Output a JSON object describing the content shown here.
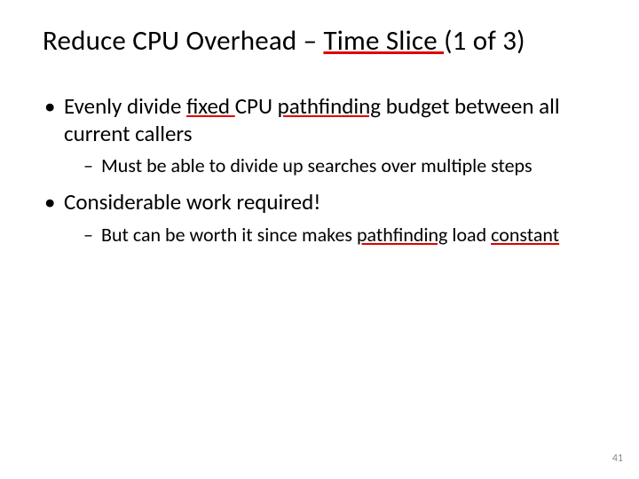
{
  "title": {
    "segments": [
      {
        "text": "Reduce CPU Overhead – ",
        "underline": false
      },
      {
        "text": "Time Slice ",
        "underline": true
      },
      {
        "text": "(1 of 3)",
        "underline": false
      }
    ]
  },
  "bullets": [
    {
      "segments": [
        {
          "text": "Evenly divide ",
          "underline": false
        },
        {
          "text": "fixed ",
          "underline": true
        },
        {
          "text": "CPU ",
          "underline": false
        },
        {
          "text": "pathfinding",
          "underline": true
        },
        {
          "text": " budget between all current callers",
          "underline": false
        }
      ],
      "sub": [
        {
          "text": "Must be able to divide up searches over multiple steps"
        }
      ]
    },
    {
      "segments": [
        {
          "text": "Considerable work required!",
          "underline": false
        }
      ],
      "sub": [
        {
          "segments": [
            {
              "text": "But can be worth it since makes ",
              "underline": false
            },
            {
              "text": "pathfinding",
              "underline": true
            },
            {
              "text": " load ",
              "underline": false
            },
            {
              "text": "constant",
              "underline": true
            }
          ]
        }
      ]
    }
  ],
  "page_number": "41"
}
